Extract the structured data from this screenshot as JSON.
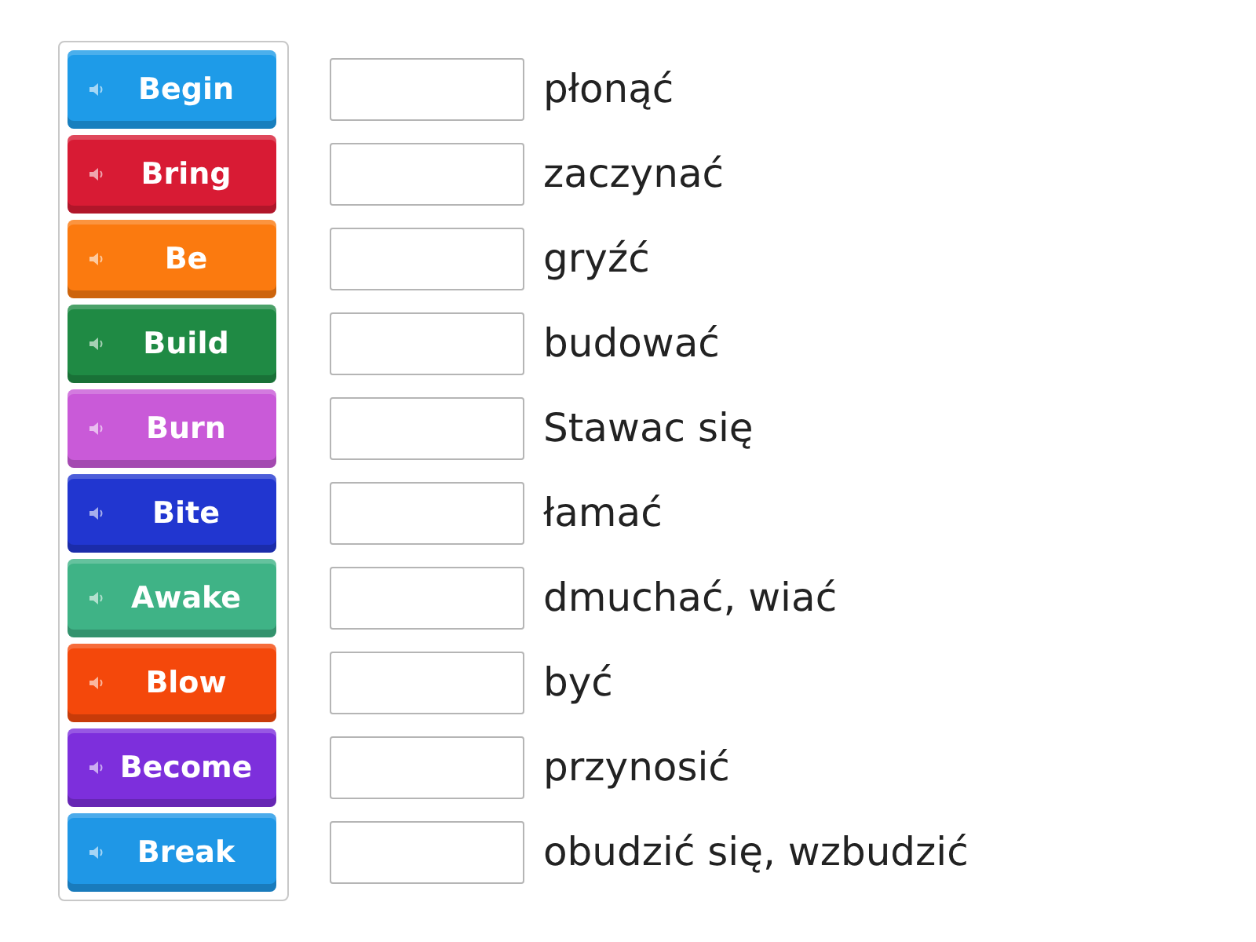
{
  "tiles": [
    {
      "label": "Begin",
      "color": "#1e9be8"
    },
    {
      "label": "Bring",
      "color": "#d81b34"
    },
    {
      "label": "Be",
      "color": "#fb7a0f"
    },
    {
      "label": "Build",
      "color": "#1f8a44"
    },
    {
      "label": "Burn",
      "color": "#c95ad8"
    },
    {
      "label": "Bite",
      "color": "#2136d0"
    },
    {
      "label": "Awake",
      "color": "#3fb386"
    },
    {
      "label": "Blow",
      "color": "#f4480b"
    },
    {
      "label": "Become",
      "color": "#7d2fdc"
    },
    {
      "label": "Break",
      "color": "#1f97e6"
    }
  ],
  "targets": [
    {
      "definition": "płonąć"
    },
    {
      "definition": "zaczynać"
    },
    {
      "definition": "gryźć"
    },
    {
      "definition": "budować"
    },
    {
      "definition": "Stawac się"
    },
    {
      "definition": "łamać"
    },
    {
      "definition": "dmuchać, wiać"
    },
    {
      "definition": "być"
    },
    {
      "definition": "przynosić"
    },
    {
      "definition": "obudzić się, wzbudzić"
    }
  ]
}
